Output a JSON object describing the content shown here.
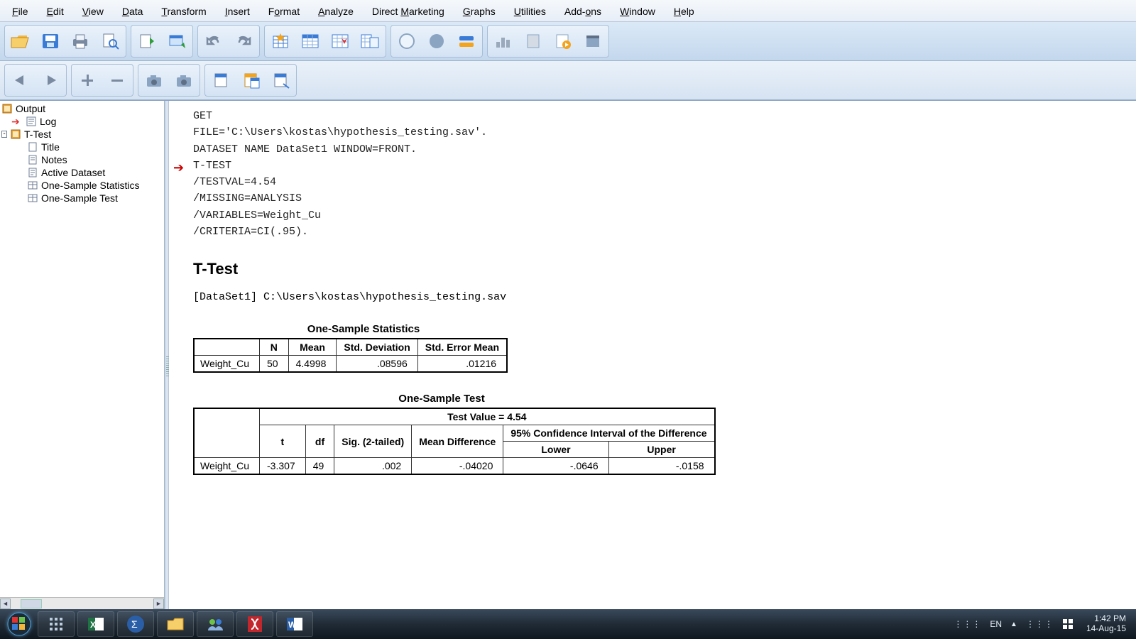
{
  "menu": {
    "file": "File",
    "edit": "Edit",
    "view": "View",
    "data": "Data",
    "transform": "Transform",
    "insert": "Insert",
    "format": "Format",
    "analyze": "Analyze",
    "direct_marketing": "Direct Marketing",
    "graphs": "Graphs",
    "utilities": "Utilities",
    "addons": "Add-ons",
    "window": "Window",
    "help": "Help"
  },
  "tree": {
    "root": "Output",
    "log": "Log",
    "ttest": "T-Test",
    "title": "Title",
    "notes": "Notes",
    "active_dataset": "Active Dataset",
    "one_sample_stats": "One-Sample Statistics",
    "one_sample_test": "One-Sample Test"
  },
  "syntax_lines": [
    "GET",
    "  FILE='C:\\Users\\kostas\\hypothesis_testing.sav'.",
    "DATASET NAME DataSet1 WINDOW=FRONT.",
    "T-TEST",
    "  /TESTVAL=4.54",
    "  /MISSING=ANALYSIS",
    "  /VARIABLES=Weight_Cu",
    "  /CRITERIA=CI(.95)."
  ],
  "section_heading": "T-Test",
  "dataset_line": "[DataSet1] C:\\Users\\kostas\\hypothesis_testing.sav",
  "stats_table": {
    "title": "One-Sample Statistics",
    "headers": {
      "n": "N",
      "mean": "Mean",
      "sd": "Std. Deviation",
      "sem": "Std. Error Mean"
    },
    "row": {
      "label": "Weight_Cu",
      "n": "50",
      "mean": "4.4998",
      "sd": ".08596",
      "sem": ".01216"
    }
  },
  "test_table": {
    "title": "One-Sample Test",
    "test_value": "Test Value = 4.54",
    "ci_header": "95% Confidence Interval of the Difference",
    "headers": {
      "t": "t",
      "df": "df",
      "sig": "Sig. (2-tailed)",
      "meandiff": "Mean Difference",
      "lower": "Lower",
      "upper": "Upper"
    },
    "row": {
      "label": "Weight_Cu",
      "t": "-3.307",
      "df": "49",
      "sig": ".002",
      "meandiff": "-.04020",
      "lower": "-.0646",
      "upper": "-.0158"
    }
  },
  "taskbar": {
    "lang": "EN",
    "time": "1:42 PM",
    "date": "14-Aug-15"
  }
}
